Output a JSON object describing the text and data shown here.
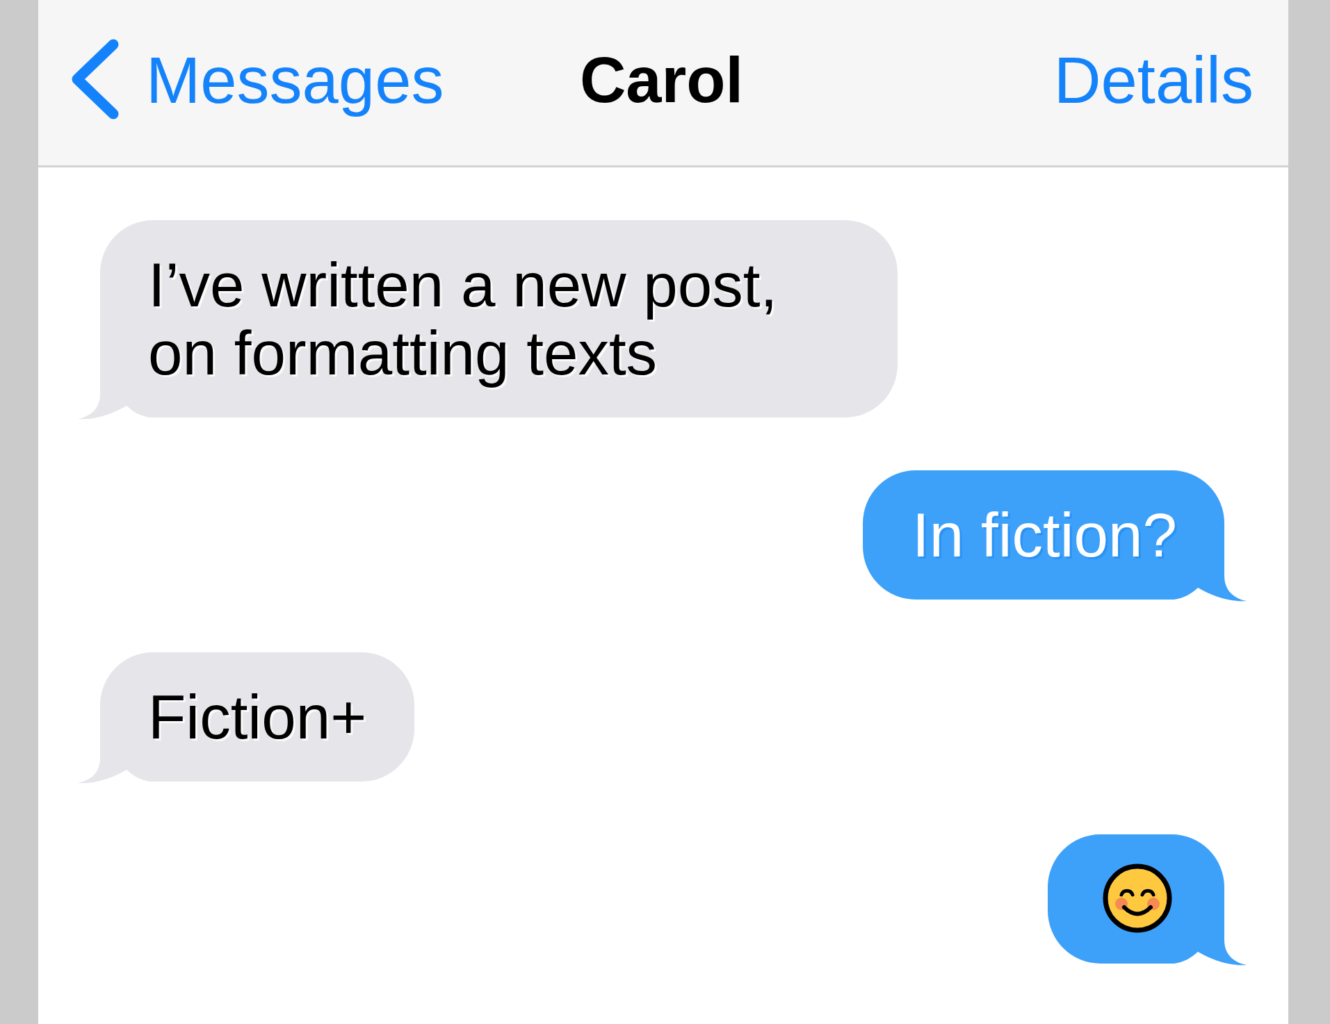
{
  "nav_bar": {
    "back_button": {
      "label": "Messages"
    },
    "title": "Carol",
    "action_button": {
      "label": "Details"
    }
  },
  "messages": [
    {
      "outgoing": false,
      "kind": "text",
      "text": "I’ve written a new post, on formatting texts"
    },
    {
      "outgoing": true,
      "kind": "text",
      "text": "In fiction?"
    },
    {
      "outgoing": false,
      "kind": "text",
      "text": "Fiction+"
    },
    {
      "outgoing": true,
      "kind": "emoji"
    }
  ]
}
